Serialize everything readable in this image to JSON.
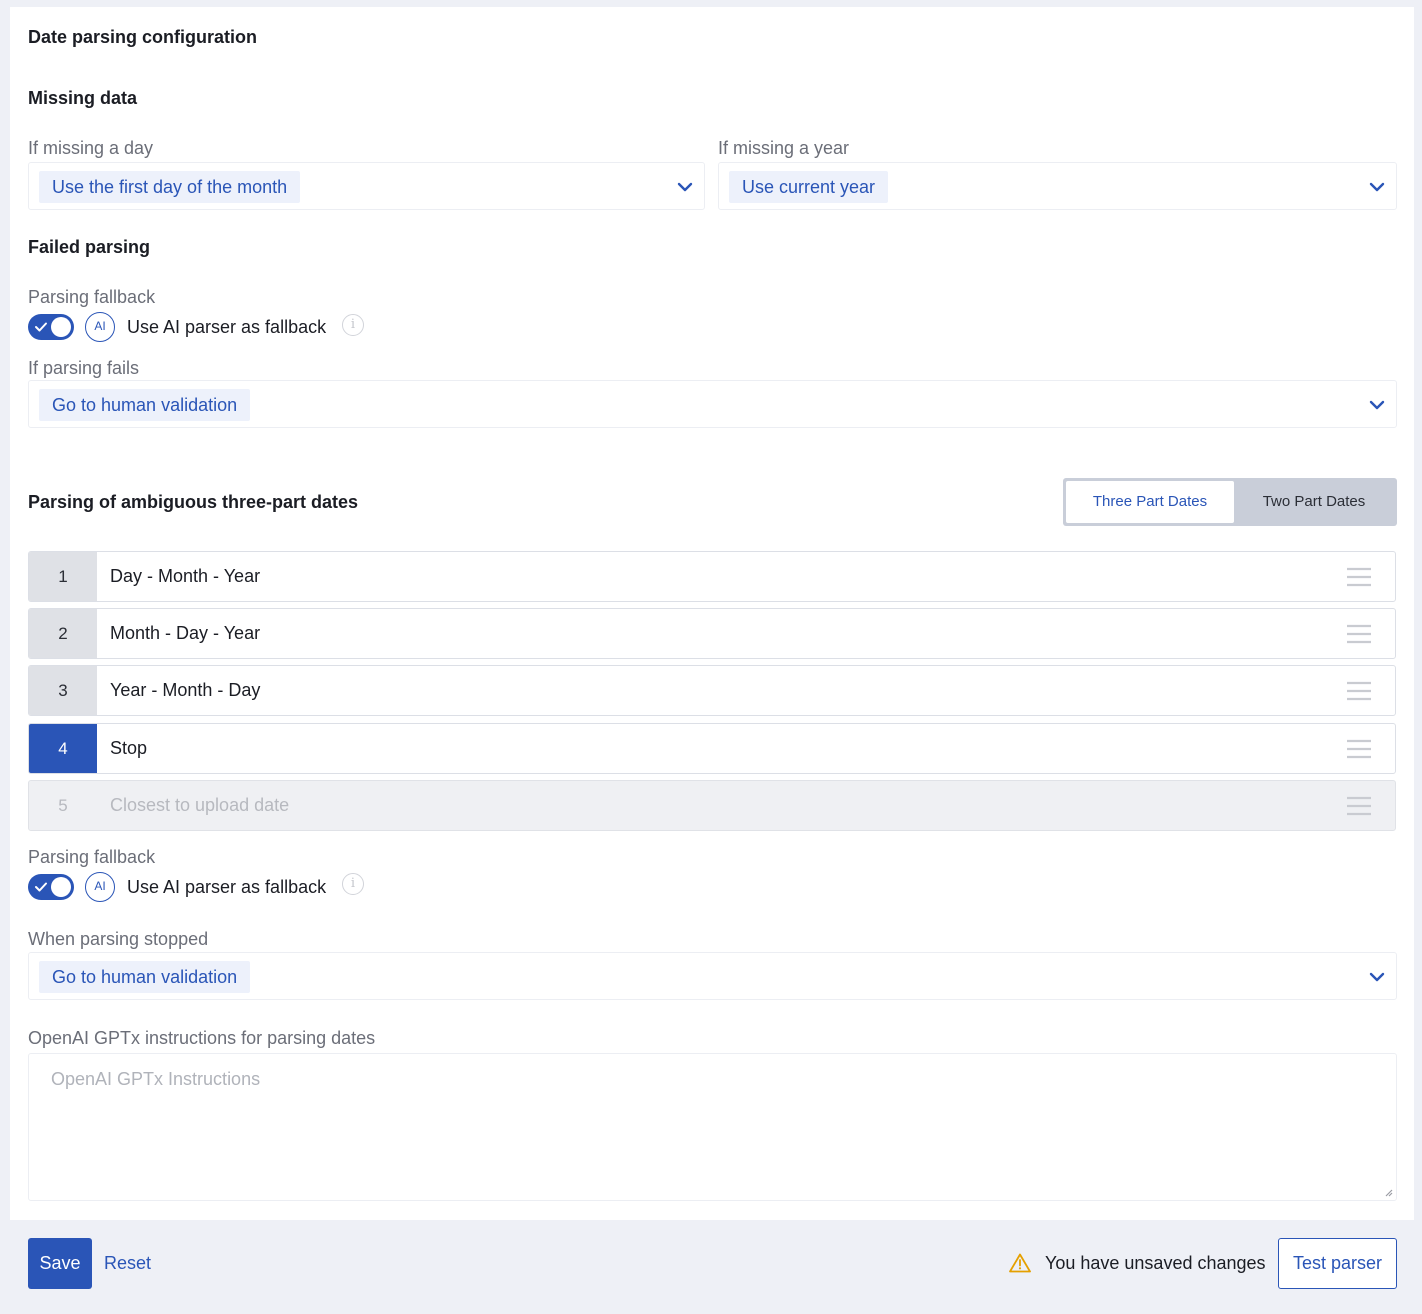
{
  "page_title": "Date parsing configuration",
  "missing_data": {
    "heading": "Missing data",
    "day": {
      "label": "If missing a day",
      "value": "Use the first day of the month"
    },
    "year": {
      "label": "If missing a year",
      "value": "Use current year"
    }
  },
  "failed_parsing": {
    "heading": "Failed parsing",
    "fallback_label": "Parsing fallback",
    "ai_badge": "AI",
    "ai_toggle_label": "Use AI parser as fallback",
    "ai_toggle_on": true,
    "info_glyph": "i",
    "fails_label": "If parsing fails",
    "fails_value": "Go to human validation"
  },
  "ambiguous": {
    "heading": "Parsing of ambiguous three-part dates",
    "tabs": [
      "Three Part Dates",
      "Two Part Dates"
    ],
    "active_tab": "Three Part Dates",
    "orders": [
      {
        "num": "1",
        "label": "Day - Month - Year",
        "state": "normal"
      },
      {
        "num": "2",
        "label": "Month - Day - Year",
        "state": "normal"
      },
      {
        "num": "3",
        "label": "Year - Month - Day",
        "state": "normal"
      },
      {
        "num": "4",
        "label": "Stop",
        "state": "selected"
      },
      {
        "num": "5",
        "label": "Closest to upload date",
        "state": "disabled"
      }
    ],
    "fallback_label": "Parsing fallback",
    "ai_badge": "AI",
    "ai_toggle_label": "Use AI parser as fallback",
    "ai_toggle_on": true,
    "info_glyph": "i",
    "stopped_label": "When parsing stopped",
    "stopped_value": "Go to human validation"
  },
  "instructions": {
    "label": "OpenAI GPTx instructions for parsing dates",
    "placeholder": "OpenAI GPTx Instructions",
    "value": ""
  },
  "footer": {
    "save_label": "Save",
    "reset_label": "Reset",
    "unsaved_text": "You have unsaved changes",
    "test_label": "Test parser"
  },
  "colors": {
    "accent": "#2a55b7",
    "chip_bg": "#edf1fb",
    "warning": "#e5a000"
  },
  "icons": {
    "chevron": "chevron-down-icon",
    "check": "check-icon",
    "info": "info-icon",
    "drag": "drag-handle-icon",
    "warning": "warning-icon"
  }
}
